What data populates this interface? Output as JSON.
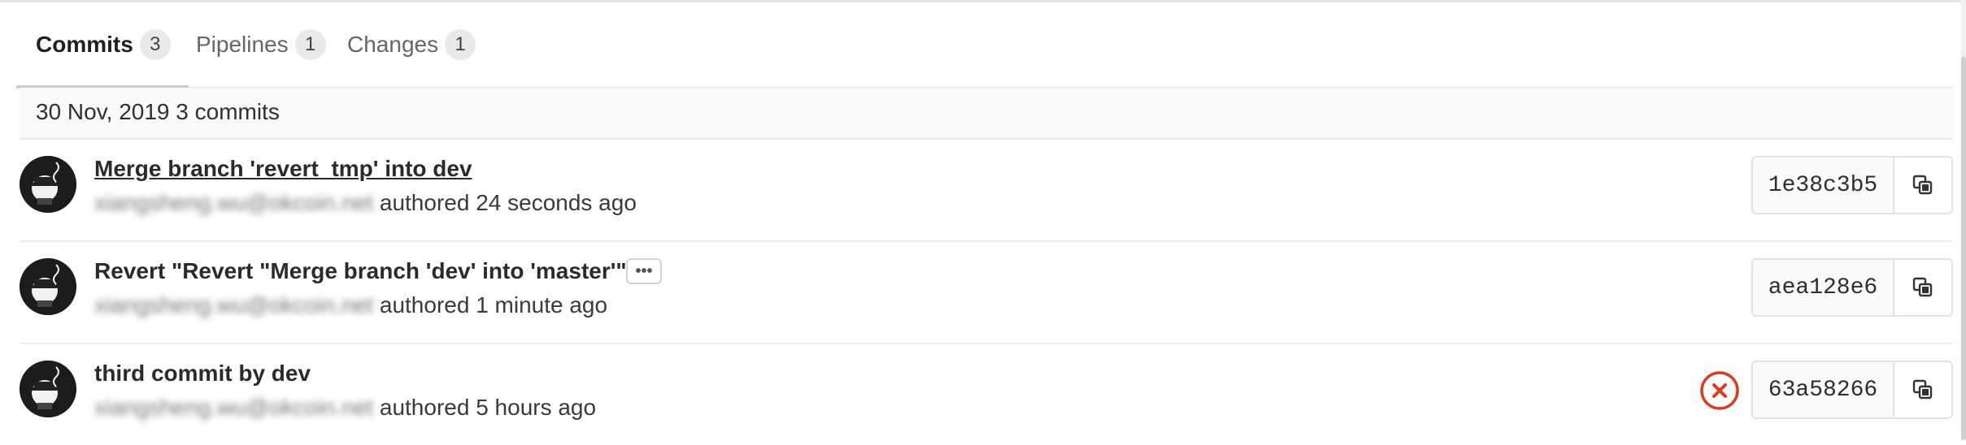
{
  "tabs": [
    {
      "label": "Commits",
      "count": "3"
    },
    {
      "label": "Pipelines",
      "count": "1"
    },
    {
      "label": "Changes",
      "count": "1"
    }
  ],
  "day_header": "30 Nov, 2019 3 commits",
  "commits": [
    {
      "title": "Merge branch 'revert_tmp' into dev",
      "author_email": "xiangsheng.wu@okcoin.net",
      "authored": "authored 24 seconds ago",
      "sha": "1e38c3b5"
    },
    {
      "title": "Revert \"Revert \"Merge branch 'dev' into 'master'\"\"",
      "more_label": "•••",
      "author_email": "xiangsheng.wu@okcoin.net",
      "authored": "authored 1 minute ago",
      "sha": "aea128e6"
    },
    {
      "title": "third commit by dev",
      "author_email": "xiangsheng.wu@okcoin.net",
      "authored": "authored 5 hours ago",
      "sha": "63a58266",
      "status": "failed"
    }
  ],
  "icons": {
    "copy": "copy-icon",
    "status_failed": "status-failed-icon",
    "avatar": "avatar"
  },
  "colors": {
    "failed": "#db3b21",
    "active_tab_underline": "#cccccc"
  }
}
